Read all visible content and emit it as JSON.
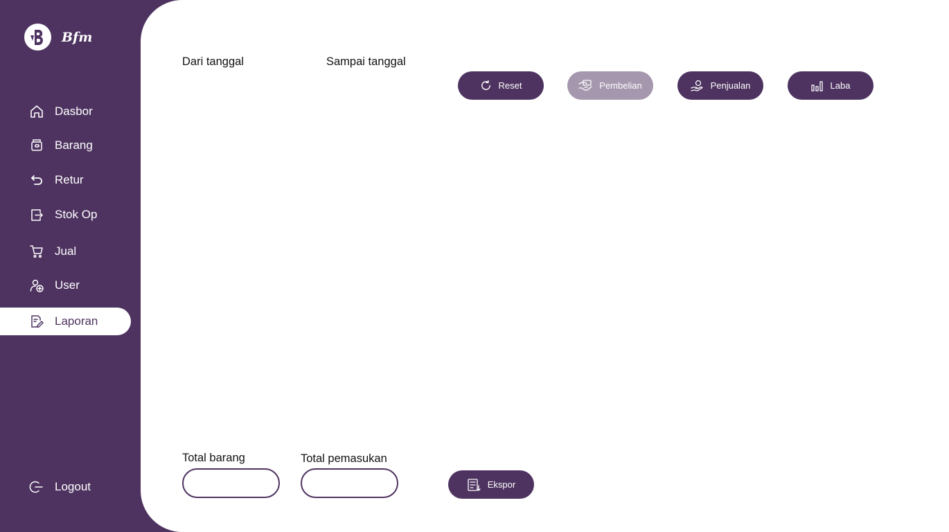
{
  "app": {
    "brand_name": "Bfm"
  },
  "sidebar": {
    "items": [
      {
        "label": "Dasbor",
        "icon": "home-icon"
      },
      {
        "label": "Barang",
        "icon": "box-icon"
      },
      {
        "label": "Retur",
        "icon": "undo-icon"
      },
      {
        "label": "Stok Op",
        "icon": "export-icon"
      },
      {
        "label": "Jual",
        "icon": "cart-icon"
      },
      {
        "label": "User",
        "icon": "user-add-icon"
      },
      {
        "label": "Laporan",
        "icon": "report-icon",
        "active": true
      }
    ],
    "logout_label": "Logout"
  },
  "filters": {
    "from_label": "Dari tanggal",
    "to_label": "Sampai tanggal"
  },
  "toolbar": {
    "reset_label": "Reset",
    "purchase_label": "Pembelian",
    "sales_label": "Penjualan",
    "profit_label": "Laba"
  },
  "summary": {
    "total_items_label": "Total barang",
    "total_items_value": "",
    "total_income_label": "Total pemasukan",
    "total_income_value": "",
    "export_label": "Ekspor"
  },
  "colors": {
    "primary": "#4e3360",
    "disabled_button": "#a597ad",
    "background": "#ffffff"
  }
}
